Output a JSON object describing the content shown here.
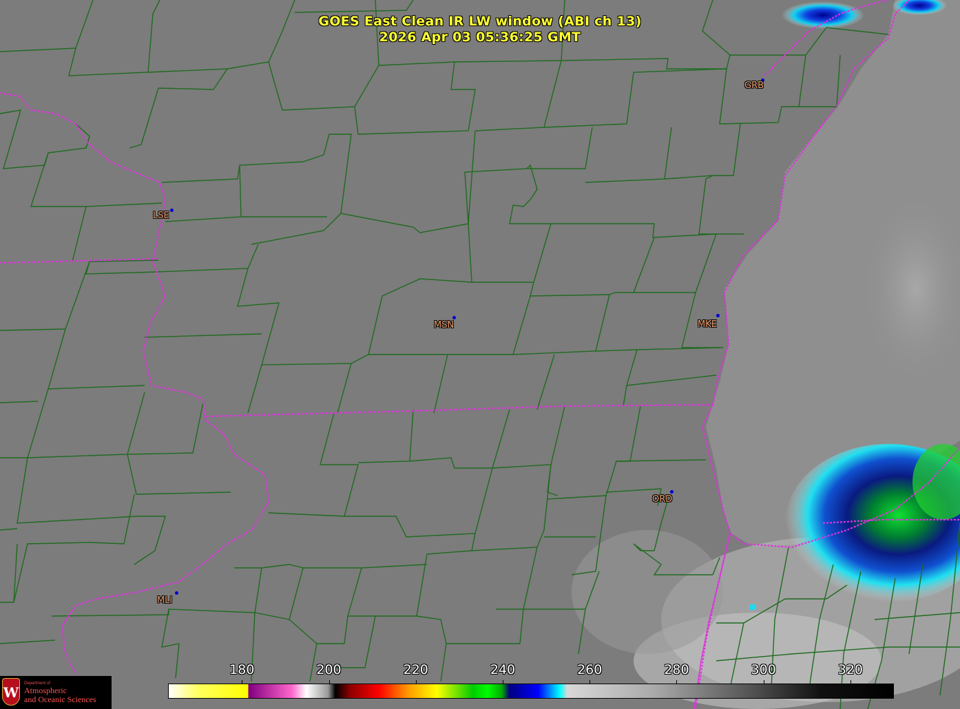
{
  "title": {
    "line1": "GOES East Clean IR LW window (ABI ch 13)",
    "line2": "2026 Apr 03  05:36:25 GMT"
  },
  "cities": [
    {
      "code": "GRB",
      "name": "grb"
    },
    {
      "code": "LSE",
      "name": "lse"
    },
    {
      "code": "MSN",
      "name": "msn"
    },
    {
      "code": "MKE",
      "name": "mke"
    },
    {
      "code": "ORD",
      "name": "ord"
    },
    {
      "code": "MLI",
      "name": "mli"
    }
  ],
  "colorbar": {
    "units_shown": "none",
    "tick_labels": [
      "180",
      "200",
      "220",
      "240",
      "260",
      "280",
      "300",
      "320"
    ],
    "tick_values": [
      180,
      200,
      220,
      240,
      260,
      280,
      300,
      320
    ],
    "range": [
      163,
      330
    ]
  },
  "logo": {
    "crest_letter": "W",
    "dept": "Department of",
    "line1": "Atmospheric",
    "line2": "and Oceanic Sciences"
  },
  "colors": {
    "county_lines": "#1f6b1f",
    "state_lines": "#dd33dd",
    "title": "#ffff33",
    "city_label": "#f0a070",
    "city_dot": "#0000d0"
  }
}
